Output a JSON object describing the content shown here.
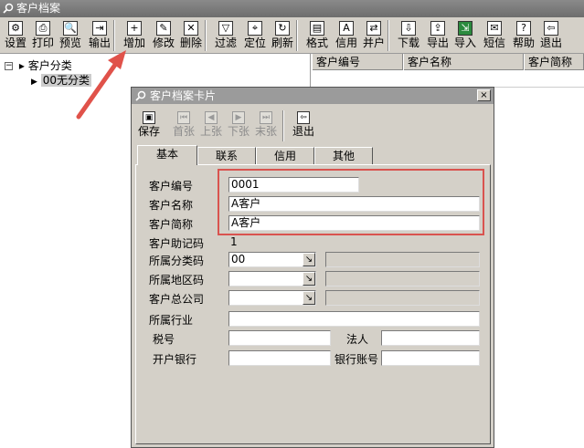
{
  "window": {
    "title": "客户档案"
  },
  "toolbar": [
    {
      "label": "设置",
      "icon": "settings-icon",
      "glyph": "⚙"
    },
    {
      "label": "打印",
      "icon": "print-icon",
      "glyph": "⎙"
    },
    {
      "label": "预览",
      "icon": "preview-icon",
      "glyph": "🔍"
    },
    {
      "label": "输出",
      "icon": "export-icon",
      "glyph": "⇥"
    },
    {
      "label": "增加",
      "icon": "add-icon",
      "glyph": "+"
    },
    {
      "label": "修改",
      "icon": "edit-icon",
      "glyph": "✎"
    },
    {
      "label": "删除",
      "icon": "delete-icon",
      "glyph": "✕"
    },
    {
      "label": "过滤",
      "icon": "filter-icon",
      "glyph": "▽"
    },
    {
      "label": "定位",
      "icon": "locate-icon",
      "glyph": "⌖"
    },
    {
      "label": "刷新",
      "icon": "refresh-icon",
      "glyph": "↻"
    },
    {
      "label": "格式",
      "icon": "format-icon",
      "glyph": "▤"
    },
    {
      "label": "信用",
      "icon": "credit-icon",
      "glyph": "A"
    },
    {
      "label": "并户",
      "icon": "merge-icon",
      "glyph": "⇄"
    },
    {
      "label": "下载",
      "icon": "download-icon",
      "glyph": "⇩"
    },
    {
      "label": "导出",
      "icon": "export-icon",
      "glyph": "⇪"
    },
    {
      "label": "导入",
      "icon": "import-icon",
      "glyph": "⇲"
    },
    {
      "label": "短信",
      "icon": "sms-icon",
      "glyph": "✉"
    },
    {
      "label": "帮助",
      "icon": "help-icon",
      "glyph": "?"
    },
    {
      "label": "退出",
      "icon": "exit-icon",
      "glyph": "⇦"
    }
  ],
  "tree": {
    "root": "客户分类",
    "expander": "⊟",
    "child_marker": "▶",
    "child": "00无分类"
  },
  "grid": {
    "columns": [
      "客户编号",
      "客户名称",
      "客户简称"
    ]
  },
  "dialog": {
    "title": "客户档案卡片",
    "close": "×",
    "toolbar": [
      {
        "label": "保存",
        "icon": "save-icon",
        "glyph": "▣",
        "enabled": true
      },
      {
        "label": "首张",
        "icon": "first-icon",
        "glyph": "⏮",
        "enabled": false
      },
      {
        "label": "上张",
        "icon": "prev-icon",
        "glyph": "◀",
        "enabled": false
      },
      {
        "label": "下张",
        "icon": "next-icon",
        "glyph": "▶",
        "enabled": false
      },
      {
        "label": "末张",
        "icon": "last-icon",
        "glyph": "⏭",
        "enabled": false
      },
      {
        "label": "退出",
        "icon": "exit-icon",
        "glyph": "⇦",
        "enabled": true
      }
    ],
    "tabs": [
      "基本",
      "联系",
      "信用",
      "其他"
    ],
    "fields": {
      "code": {
        "label": "客户编号",
        "value": "0001"
      },
      "name": {
        "label": "客户名称",
        "value": "A客户"
      },
      "short_name": {
        "label": "客户简称",
        "value": "A客户"
      },
      "mnemonic": {
        "label": "客户助记码",
        "value": "1"
      },
      "category": {
        "label": "所属分类码",
        "value": "00"
      },
      "region": {
        "label": "所属地区码",
        "value": ""
      },
      "parent": {
        "label": "客户总公司",
        "value": ""
      },
      "industry": {
        "label": "所属行业",
        "value": ""
      },
      "tax_no": {
        "label": "税号",
        "value": ""
      },
      "legal_rep": {
        "label": "法人",
        "value": ""
      },
      "bank": {
        "label": "开户银行",
        "value": ""
      },
      "bank_account": {
        "label": "银行账号",
        "value": ""
      }
    },
    "lookup_glyph": "↘"
  },
  "colors": {
    "highlight": "#d9534f",
    "arrow": "#e0524a",
    "dialog_title": "#9b9b9b"
  }
}
